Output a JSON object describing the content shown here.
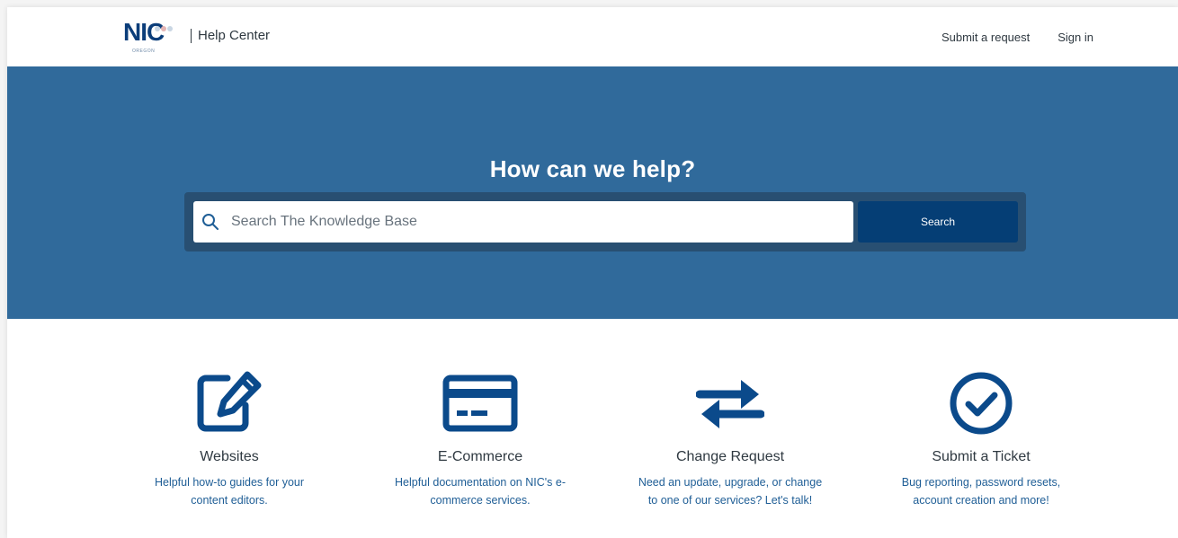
{
  "header": {
    "logo_text": "NIC",
    "logo_subtext": "OREGON",
    "title": "Help Center",
    "nav": [
      {
        "label": "Submit a request"
      },
      {
        "label": "Sign in"
      }
    ]
  },
  "hero": {
    "title": "How can we help?",
    "search_placeholder": "Search The Knowledge Base",
    "search_value": "",
    "search_button": "Search"
  },
  "categories": [
    {
      "icon": "edit-icon",
      "title": "Websites",
      "desc_line1": "Helpful how-to guides for your",
      "desc_line2": "content editors."
    },
    {
      "icon": "credit-card-icon",
      "title": "E-Commerce",
      "desc_line1": "Helpful documentation on NIC's e-",
      "desc_line2": "commerce services."
    },
    {
      "icon": "exchange-arrows-icon",
      "title": "Change Request",
      "desc_line1": "Need an update, upgrade, or change",
      "desc_line2": "to one of our services? Let's talk!"
    },
    {
      "icon": "check-circle-icon",
      "title": "Submit a Ticket",
      "desc_line1": "Bug reporting, password resets,",
      "desc_line2": "account creation and more!"
    }
  ],
  "colors": {
    "brand_blue": "#0b3d7a",
    "hero_bg": "#306a9b",
    "search_frame": "#284f72",
    "search_button": "#053e75",
    "link_blue": "#1f5e96"
  }
}
